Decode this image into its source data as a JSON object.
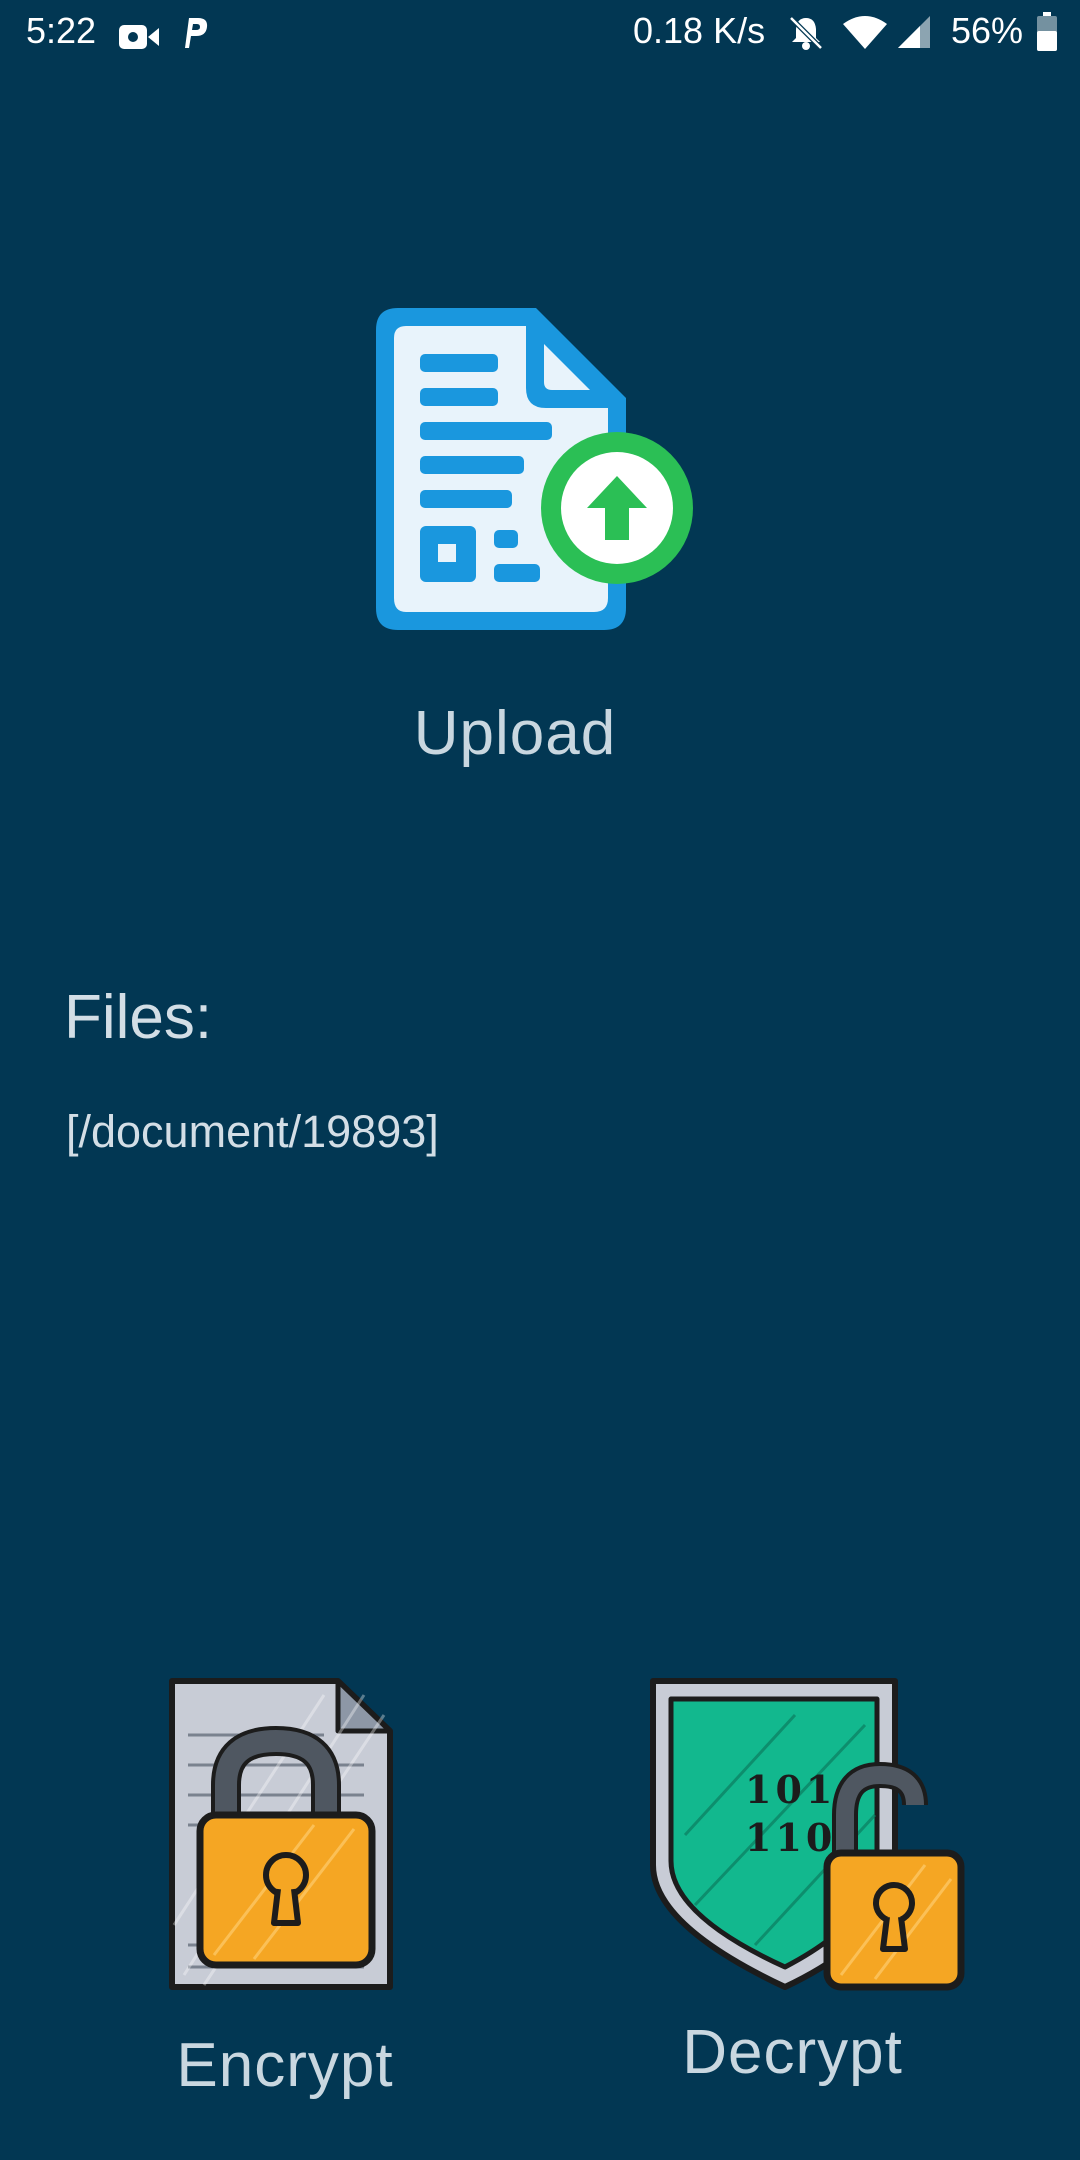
{
  "status_bar": {
    "time": "5:22",
    "network_speed": "0.18 K/s",
    "battery_percent": "56%",
    "icons": [
      "video-camera-icon",
      "p-icon",
      "bell-muted-icon",
      "wifi-icon",
      "signal-icon",
      "battery-icon"
    ]
  },
  "upload": {
    "label": "Upload",
    "icon": "document-upload-icon"
  },
  "files": {
    "heading": "Files:",
    "value": "[/document/19893]"
  },
  "actions": {
    "encrypt_label": "Encrypt",
    "decrypt_label": "Decrypt",
    "encrypt_icon": "locked-document-icon",
    "decrypt_icon": "shield-unlock-icon"
  },
  "colors": {
    "background": "#023753",
    "text": "#d3dee6",
    "upload_blue": "#1a97de",
    "upload_green": "#2bbf55",
    "lock_orange": "#f5a623",
    "shield_green": "#12b88e"
  },
  "decrypt_icon_text": [
    "101",
    "110"
  ]
}
